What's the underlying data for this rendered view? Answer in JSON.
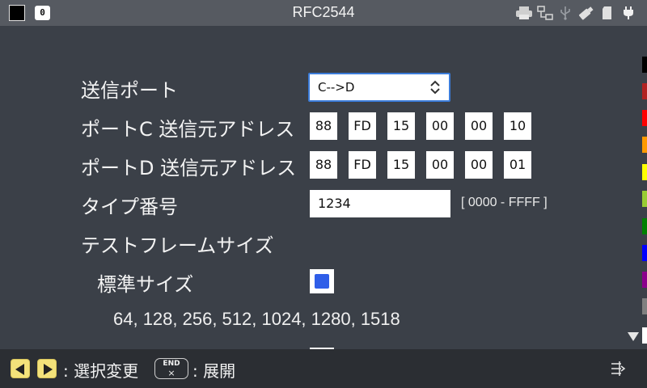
{
  "header": {
    "title": "RFC2544",
    "indicator_label": "0",
    "status_icons": [
      "printer-icon",
      "network-icon",
      "usb-icon",
      "usb-drive-icon",
      "sd-card-icon",
      "power-plug-icon"
    ]
  },
  "form": {
    "send_port": {
      "label": "送信ポート",
      "value": "C-->D"
    },
    "port_c_address": {
      "label": "ポートC 送信元アドレス",
      "bytes": [
        "88",
        "FD",
        "15",
        "00",
        "00",
        "10"
      ]
    },
    "port_d_address": {
      "label": "ポートD 送信元アドレス",
      "bytes": [
        "88",
        "FD",
        "15",
        "00",
        "00",
        "01"
      ]
    },
    "type_number": {
      "label": "タイプ番号",
      "value": "1234",
      "range": "[ 0000 - FFFF ]"
    },
    "test_frame_size": {
      "label": "テストフレームサイズ"
    },
    "standard_size": {
      "label": "標準サイズ",
      "checked": true,
      "sizes": "64, 128, 256, 512, 1024, 1280, 1518"
    }
  },
  "palette": {
    "colors": [
      "#000000",
      "#b22222",
      "#ff0000",
      "#ff9900",
      "#ffff00",
      "#99cc33",
      "#008000",
      "#0000ff",
      "#8b008b",
      "#808080",
      "#ffffff"
    ]
  },
  "footer": {
    "select_change": ": 選択変更",
    "end_key_label": "END",
    "end_key_symbol": "×",
    "expand": ": 展開"
  }
}
